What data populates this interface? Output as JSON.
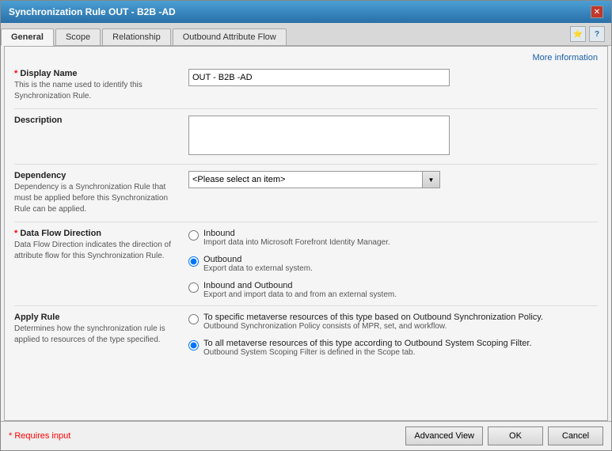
{
  "window": {
    "title": "Synchronization Rule OUT - B2B -AD",
    "close_label": "✕"
  },
  "tabs": [
    {
      "id": "general",
      "label": "General",
      "active": true
    },
    {
      "id": "scope",
      "label": "Scope",
      "active": false
    },
    {
      "id": "relationship",
      "label": "Relationship",
      "active": false
    },
    {
      "id": "outbound",
      "label": "Outbound Attribute Flow",
      "active": false
    }
  ],
  "tab_icons": {
    "star_icon": "★",
    "help_icon": "?"
  },
  "more_info": "More information",
  "fields": {
    "display_name": {
      "label": "Display Name",
      "required_star": "*",
      "description": "This is the name used to identify this Synchronization Rule.",
      "value": "OUT - B2B -AD",
      "placeholder": ""
    },
    "description": {
      "label": "Description",
      "value": "",
      "placeholder": ""
    },
    "dependency": {
      "label": "Dependency",
      "description": "Dependency is a Synchronization Rule that must be applied before this Synchronization Rule can be applied.",
      "placeholder": "<Please select an item>",
      "options": [
        "<Please select an item>"
      ]
    },
    "data_flow_direction": {
      "label": "Data Flow Direction",
      "required_star": "*",
      "description": "Data Flow Direction indicates the direction of attribute flow for this Synchronization Rule.",
      "options": [
        {
          "value": "inbound",
          "label": "Inbound",
          "sublabel": "Import data into Microsoft Forefront Identity Manager.",
          "selected": false
        },
        {
          "value": "outbound",
          "label": "Outbound",
          "sublabel": "Export data to external system.",
          "selected": true
        },
        {
          "value": "inbound_outbound",
          "label": "Inbound and Outbound",
          "sublabel": "Export and import data to and from an external system.",
          "selected": false
        }
      ]
    },
    "apply_rule": {
      "label": "Apply Rule",
      "description": "Determines how the synchronization rule is applied to resources of the type specified.",
      "options": [
        {
          "value": "specific",
          "label": "To specific metaverse resources of this type based on Outbound Synchronization Policy.",
          "sublabel": "Outbound Synchronization Policy consists of MPR, set, and workflow.",
          "selected": false
        },
        {
          "value": "all",
          "label": "To all metaverse resources of this type according to Outbound System Scoping Filter.",
          "sublabel": "Outbound System Scoping Filter is defined in the Scope tab.",
          "selected": true
        }
      ]
    }
  },
  "footer": {
    "requires_input": "* Requires input",
    "advanced_view": "Advanced View",
    "ok": "OK",
    "cancel": "Cancel"
  }
}
